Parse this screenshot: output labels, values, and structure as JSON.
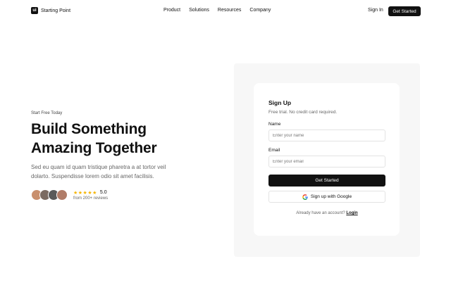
{
  "nav": {
    "logo_text": "ui",
    "brand": "Starting Point",
    "menu": [
      "Product",
      "Solutions",
      "Resources",
      "Company"
    ],
    "signin": "Sign In",
    "cta": "Get Started"
  },
  "hero": {
    "eyebrow": "Start Free Today",
    "headline_line1": "Build Something",
    "headline_line2": "Amazing Together",
    "subtext": "Sed eu quam id quam tristique pharetra a at tortor veil dolarto. Suspendisse lorem odio sit amet facilisis.",
    "stars": "★★★★★",
    "rating": "5.0",
    "reviews": "from 200+ reviews"
  },
  "signup": {
    "title": "Sign Up",
    "subtitle": "Free trial. No credit card required.",
    "name_label": "Name",
    "name_placeholder": "Enter your name",
    "email_label": "Email",
    "email_placeholder": "Enter your email",
    "submit": "Get Started",
    "google": "Sign up with Google",
    "login_prompt": "Already have an account?",
    "login_link": "Login"
  },
  "colors": {
    "primary": "#111111",
    "star": "#f5b400",
    "panel_bg": "#f7f7f7",
    "muted_text": "#666666"
  }
}
